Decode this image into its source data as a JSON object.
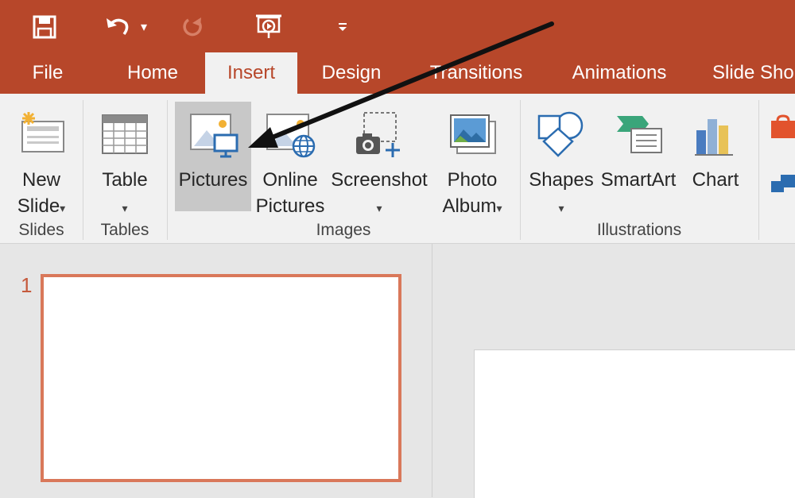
{
  "quick_access": {
    "save_icon": "save-icon",
    "undo_icon": "undo-icon",
    "undo_dropdown": "▾",
    "redo_icon": "redo-icon",
    "present_icon": "present-from-start-icon",
    "customize_icon": "customize-toolbar-icon"
  },
  "tabs": [
    {
      "label": "File"
    },
    {
      "label": "Home"
    },
    {
      "label": "Insert",
      "active": true
    },
    {
      "label": "Design"
    },
    {
      "label": "Transitions"
    },
    {
      "label": "Animations"
    },
    {
      "label": "Slide Sho"
    }
  ],
  "ribbon": {
    "new_slide": {
      "line1": "New",
      "line2": "Slide",
      "caret": "▾"
    },
    "table": {
      "line1": "Table",
      "caret": "▾"
    },
    "pictures": {
      "line1": "Pictures"
    },
    "online_pictures": {
      "line1": "Online",
      "line2": "Pictures"
    },
    "screenshot": {
      "line1": "Screenshot",
      "caret": "▾"
    },
    "photo_album": {
      "line1": "Photo",
      "line2": "Album",
      "caret": "▾"
    },
    "shapes": {
      "line1": "Shapes",
      "caret": "▾"
    },
    "smartart": {
      "line1": "SmartArt"
    },
    "chart": {
      "line1": "Chart"
    },
    "groups": {
      "slides": "Slides",
      "tables": "Tables",
      "images": "Images",
      "illustrations": "Illustrations"
    }
  },
  "slides_pane": {
    "slide_number": "1"
  },
  "colors": {
    "accent": "#b7472a",
    "ribbon_bg": "#f1f1f1",
    "selected": "#c8c8c8",
    "thumb_border": "#d9785a"
  }
}
